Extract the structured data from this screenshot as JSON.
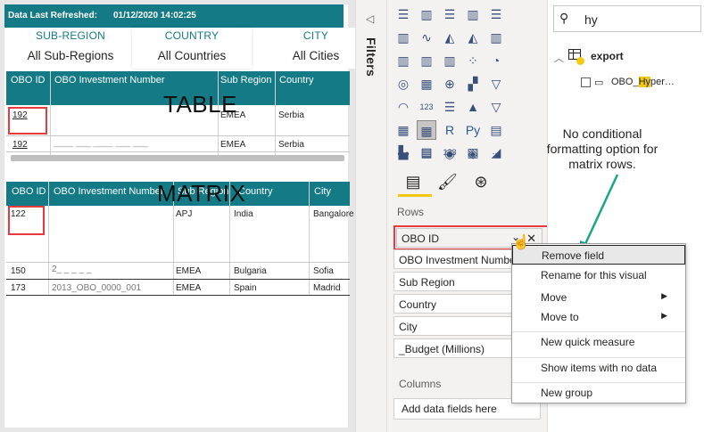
{
  "header": {
    "refresh_label": "Data Last Refreshed:",
    "refresh_value": "01/12/2020 14:02:25"
  },
  "slicers": [
    {
      "label": "SUB-REGION",
      "value": "All Sub-Regions"
    },
    {
      "label": "COUNTRY",
      "value": "All Countries"
    },
    {
      "label": "CITY",
      "value": "All Cities"
    }
  ],
  "table": {
    "title": "TABLE",
    "columns": [
      "OBO ID",
      "OBO Investment Number",
      "Sub Region",
      "Country"
    ],
    "rows": [
      {
        "id": "192",
        "inv": "",
        "sub": "EMEA",
        "country": "Serbia"
      },
      {
        "id": "192",
        "inv": "____ ___ ____ ___ ___",
        "sub": "EMEA",
        "country": "Serbia"
      }
    ]
  },
  "matrix": {
    "title": "MATRIX",
    "columns": [
      "OBO ID",
      "OBO Investment Number",
      "Sub Region",
      "Country",
      "City"
    ],
    "rows": [
      {
        "id": "122",
        "inv": "",
        "sub": "APJ",
        "country": "India",
        "city": "Bangalore"
      },
      {
        "id": "150",
        "inv": "2_  _  _  _  _",
        "sub": "EMEA",
        "country": "Bulgaria",
        "city": "Sofia"
      },
      {
        "id": "173",
        "inv": "2013_OBO_0000_001",
        "sub": "EMEA",
        "country": "Spain",
        "city": "Madrid"
      }
    ]
  },
  "filters": {
    "label": "Filters",
    "collapse_glyph": "◁"
  },
  "visualizations": {
    "icon_names": [
      "stacked-bar-icon",
      "stacked-column-icon",
      "clustered-bar-icon",
      "clustered-column-icon",
      "100-bar-icon",
      "100-column-icon",
      "line-chart-icon",
      "area-chart-icon",
      "stacked-area-icon",
      "line-column-icon",
      "line-clustered-column-icon",
      "ribbon-chart-icon",
      "waterfall-icon",
      "scatter-icon",
      "pie-icon",
      "donut-icon",
      "treemap-icon",
      "map-icon",
      "filled-map-icon",
      "funnel-icon",
      "gauge-icon",
      "card-icon",
      "multi-row-card-icon",
      "kpi-icon",
      "slicer-icon",
      "table-icon",
      "matrix-icon",
      "r-visual-icon",
      "python-visual-icon",
      "key-influencers-icon",
      "decomposition-tree-icon",
      "qna-icon",
      "arcgis-icon",
      "power-apps-icon",
      "more-visuals-icon"
    ],
    "icon_glyphs": [
      "☰",
      "▥",
      "☰",
      "▥",
      "☰",
      "▥",
      "∿",
      "◭",
      "◭",
      "▥",
      "▥",
      "▥",
      "▥",
      "⁘",
      "◔",
      "◎",
      "▦",
      "⊕",
      "▞",
      "▽",
      "◠",
      "123",
      "☰",
      "▲",
      "▽",
      "▦",
      "▦",
      "R",
      "Py",
      "▤",
      "⊶",
      "☐",
      "◉",
      "◈",
      "···"
    ],
    "icon_colors": [
      "#3a4f7a",
      "#3a4f7a",
      "#3a4f7a",
      "#3a4f7a",
      "#3a4f7a",
      "#3a4f7a",
      "#3a4f7a",
      "#3a4f7a",
      "#3a4f7a",
      "#3a4f7a",
      "#3a4f7a",
      "#3a4f7a",
      "#3a4f7a",
      "#3a4f7a",
      "#3a4f7a",
      "#3a4f7a",
      "#3a4f7a",
      "#3a4f7a",
      "#3a4f7a",
      "#3a4f7a",
      "#3a4f7a",
      "#3a4f7a",
      "#3a4f7a",
      "#3a4f7a",
      "#3a4f7a",
      "#3a4f7a",
      "#3a4f7a",
      "#2b5b9a",
      "#2b5b9a",
      "#3a4f7a",
      "#3a4f7a",
      "#3a4f7a",
      "#3a4f7a",
      "#3a4f7a",
      "#252423"
    ],
    "selected_index": 26,
    "custom_visuals": [
      "custom-visual-1-icon",
      "custom-visual-2-icon",
      "custom-visual-3-icon",
      "custom-visual-4-icon",
      "custom-visual-5-icon"
    ],
    "custom_glyphs": [
      "▙",
      "▦",
      "123",
      "▧",
      "◢"
    ],
    "tabs": [
      "fields-tab-icon",
      "format-tab-icon",
      "analytics-tab-icon"
    ],
    "tab_glyphs": [
      "▤",
      "🖌",
      "⊛"
    ],
    "rows_label": "Rows",
    "rows_fields": [
      "OBO ID",
      "OBO Investment Number",
      "Sub Region",
      "Country",
      "City",
      "_Budget (Millions)"
    ],
    "columns_label": "Columns",
    "columns_placeholder": "Add data fields here",
    "remove_glyph": "✕",
    "chevron_glyph": "⌄"
  },
  "fields": {
    "search_value": "hy",
    "search_glyph": "⚲",
    "table_name": "export",
    "table_chevron": "︿",
    "field_name": "OBO_Hyper…",
    "field_highlight": "Hy",
    "field_prefix": "OBO_",
    "field_suffix": "per…"
  },
  "context_menu": {
    "items": [
      {
        "label": "Remove field",
        "arrow": ""
      },
      {
        "label": "Rename for this visual",
        "arrow": ""
      },
      {
        "label": "Move",
        "arrow": "▶"
      },
      {
        "label": "Move to",
        "arrow": "▶"
      },
      {
        "label": "New quick measure",
        "arrow": ""
      },
      {
        "label": "Show items with no data",
        "arrow": ""
      },
      {
        "label": "New group",
        "arrow": ""
      }
    ]
  },
  "annotation": {
    "text": "No conditional formatting option for matrix rows."
  },
  "colors": {
    "accent": "#137a86",
    "highlight_box": "#e8393e",
    "arrow": "#1aa58a",
    "tab_underline": "#f2c811",
    "search_highlight": "#f2c811"
  }
}
